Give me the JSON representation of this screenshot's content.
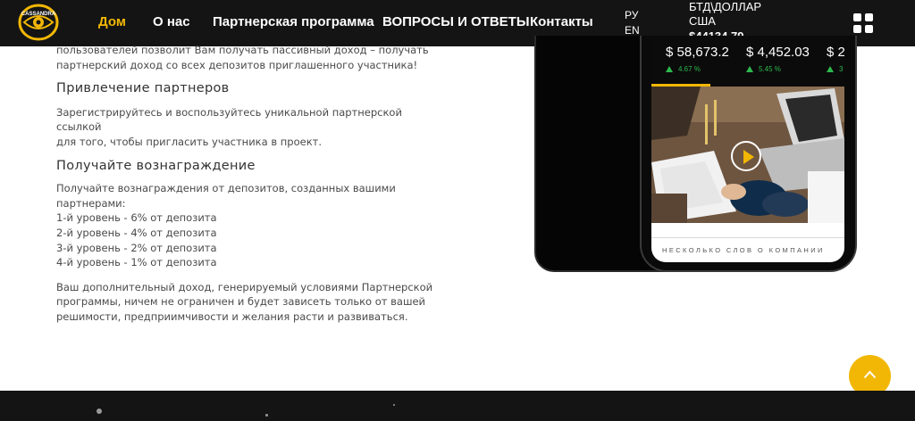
{
  "header": {
    "logo_text": "CASSANDRA",
    "nav": [
      {
        "label": "Дом",
        "active": true
      },
      {
        "label": "О нас",
        "active": false
      },
      {
        "label": "Партнерская программа",
        "active": false
      },
      {
        "label": "ВОПРОСЫ И ОТВЕТЫ",
        "active": false
      },
      {
        "label": "Контакты",
        "active": false
      }
    ],
    "languages": [
      "РУ",
      "EN"
    ],
    "rate": {
      "label_line1": "БТД\\ДОЛЛАР",
      "label_line2": "США",
      "value": "$44134.79"
    },
    "menu_icon": "grid-menu-icon"
  },
  "content": {
    "intro_line1": "пользователей позволит Вам получать пассивный доход – получать",
    "intro_line2": "партнерский доход со всех депозитов приглашенного участника!",
    "heading1": "Привлечение партнеров",
    "para1_line1": "Зарегистрируйтесь и воспользуйтесь уникальной партнерской ссылкой",
    "para1_line2": "для того, чтобы пригласить участника в проект.",
    "heading2": "Получайте вознаграждение",
    "rewards_intro": "Получайте вознаграждения от депозитов, созданных вашими партнерами:",
    "levels": [
      "1-й уровень - 6% от депозита",
      "2-й уровень - 4% от депозита",
      "3-й уровень - 2% от депозита",
      "4-й уровень - 1% от депозита"
    ],
    "para2_line1": "Ваш дополнительный доход, генерируемый условиями Партнерской",
    "para2_line2": "программы, ничем не ограничен и будет зависеть только от вашей",
    "para2_line3": "решимости, предприимчивости и желания расти и развиваться."
  },
  "phone": {
    "tickers": [
      {
        "price": "$ 58,673.2",
        "change": "4.67 %"
      },
      {
        "price": "$ 4,452.03",
        "change": "5.45 %"
      },
      {
        "price": "$ 2",
        "change": "3"
      }
    ],
    "caption": "НЕСКОЛЬКО СЛОВ О КОМПАНИИ",
    "play_icon": "play-icon"
  },
  "colors": {
    "accent": "#f2b705",
    "header_bg": "#141414",
    "positive": "#2db84d"
  }
}
